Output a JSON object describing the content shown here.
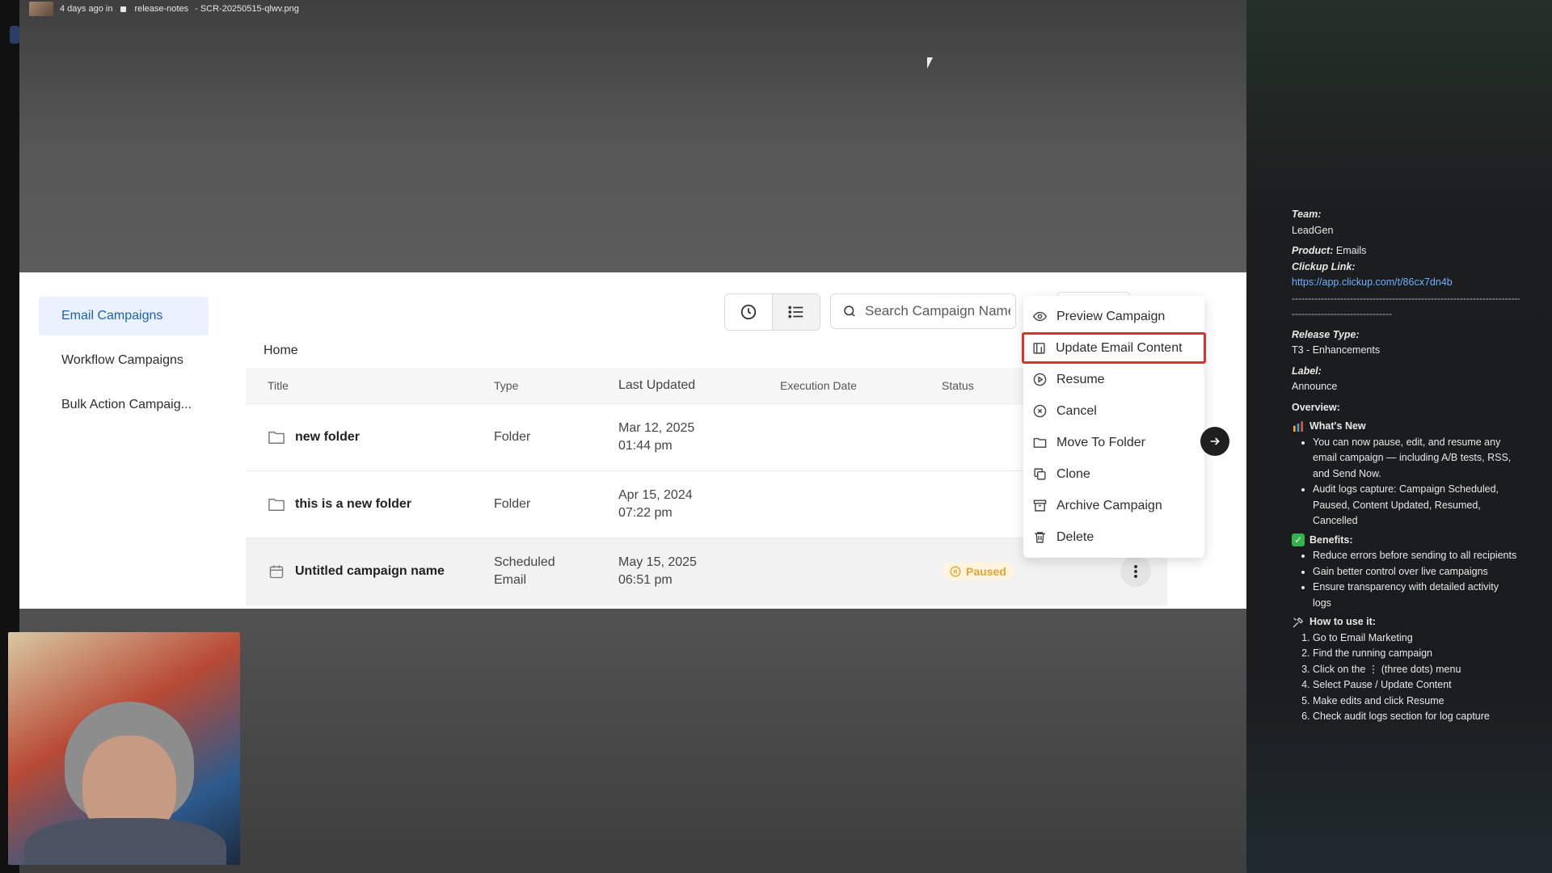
{
  "topbar": {
    "time": "4 days ago in",
    "channel": "release-notes",
    "file": "- SCR-20250515-qlwv.png"
  },
  "sidebar": {
    "items": [
      {
        "label": "Email Campaigns",
        "active": true
      },
      {
        "label": "Workflow Campaigns",
        "active": false
      },
      {
        "label": "Bulk Action Campaig...",
        "active": false
      }
    ]
  },
  "toolbar": {
    "history_icon": "clock-icon",
    "list_icon": "list-icon",
    "search_placeholder": "Search Campaign Name"
  },
  "breadcrumb": "Home",
  "table": {
    "headers": [
      "Title",
      "Type",
      "Last Updated",
      "Execution Date",
      "Status"
    ],
    "rows": [
      {
        "title": "new folder",
        "type": "Folder",
        "updated_date": "Mar 12, 2025",
        "updated_time": "01:44 pm",
        "icon": "folder-icon",
        "status": ""
      },
      {
        "title": "this is a new folder",
        "type": "Folder",
        "updated_date": "Apr 15, 2024",
        "updated_time": "07:22 pm",
        "icon": "folder-icon",
        "status": ""
      },
      {
        "title": "Untitled campaign name",
        "type": "Scheduled",
        "type2": "Email",
        "updated_date": "May 15, 2025",
        "updated_time": "06:51 pm",
        "icon": "calendar-icon",
        "status": "Paused"
      }
    ]
  },
  "context_menu": {
    "items": [
      {
        "label": "Preview Campaign",
        "icon": "eye-icon"
      },
      {
        "label": "Update Email Content",
        "icon": "content-icon",
        "highlighted": true
      },
      {
        "label": "Resume",
        "icon": "play-icon"
      },
      {
        "label": "Cancel",
        "icon": "cancel-icon"
      },
      {
        "label": "Move To Folder",
        "icon": "folder-icon"
      },
      {
        "label": "Clone",
        "icon": "clone-icon"
      },
      {
        "label": "Archive Campaign",
        "icon": "archive-icon"
      },
      {
        "label": "Delete",
        "icon": "trash-icon"
      }
    ]
  },
  "notes": {
    "team_label": "Team:",
    "team": "LeadGen",
    "product_label": "Product:",
    "product": "Emails",
    "clickup_label": "Clickup Link:",
    "clickup_url": "https://app.clickup.com/t/86cx7dn4b",
    "sep1": "------------------------------------------------------------------------",
    "sep2": "-------------------------------",
    "release_type_label": "Release Type:",
    "release_type": "T3 - Enhancements",
    "label_label": "Label:",
    "label": "Announce",
    "overview_label": "Overview:",
    "whats_new": "What's New",
    "whats_new_items": [
      "You can now pause, edit, and resume any email campaign — including A/B tests, RSS, and Send Now.",
      "Audit logs capture: Campaign Scheduled, Paused, Content Updated, Resumed, Cancelled"
    ],
    "benefits": "Benefits:",
    "benefits_items": [
      "Reduce errors before sending to all recipients",
      "Gain better control over live campaigns",
      "Ensure transparency with detailed activity logs"
    ],
    "how_to": "How to use it:",
    "how_to_items": [
      "Go to Email Marketing",
      "Find the running campaign",
      "Click on the ⋮ (three dots) menu",
      "Select Pause / Update Content",
      "Make edits and click Resume",
      "Check audit logs section for log capture"
    ]
  },
  "colors": {
    "accent": "#1f5fbf",
    "highlight_border": "#d9342b",
    "paused": "#e3a432"
  }
}
